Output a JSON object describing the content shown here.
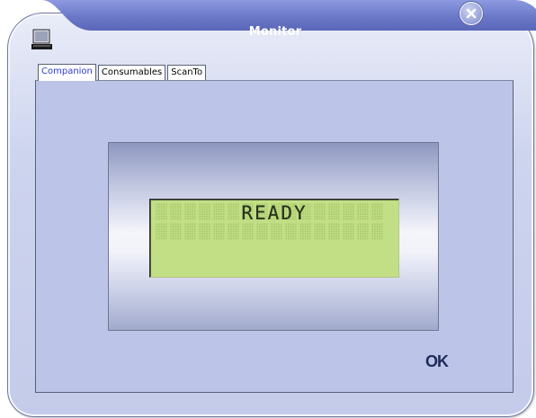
{
  "window": {
    "title": "Monitor"
  },
  "icons": {
    "app_icon": "computer-monitor-icon",
    "close_icon": "close-icon"
  },
  "tabs": [
    {
      "label": "Companion",
      "active": true
    },
    {
      "label": "Consumables",
      "active": false
    },
    {
      "label": "ScanTo",
      "active": false
    }
  ],
  "lcd": {
    "message": "READY"
  },
  "buttons": {
    "ok_label": "OK"
  },
  "colors": {
    "title_bar": "#6b78c8",
    "active_tab_text": "#2c3cd4",
    "lcd_background": "#c2df86",
    "window_body": "#c4cbea"
  }
}
